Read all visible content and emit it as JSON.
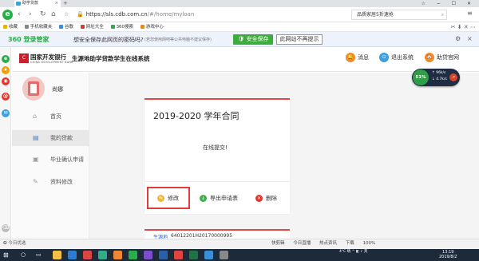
{
  "browser": {
    "tab_title": "助学贷款",
    "tab_close": "×",
    "new_tab": "+",
    "window_controls": "☆ − ☐ ✕",
    "url_domain": "https://sls.cdb.com.cn",
    "url_path": "/#/home/myloan",
    "search_text": "品质家居5折速抢",
    "menu": "≡",
    "bookmarks": [
      "收藏",
      "手机收藏夹",
      "谷歌",
      "网址大全",
      "360搜索",
      "游戏中心"
    ],
    "bookmark_colors": [
      "#f2b000",
      "#888888",
      "#3c8be0",
      "#e2362c",
      "#2aae49",
      "#e88a1a"
    ],
    "password_bar": {
      "brand": "360 登录管家",
      "question": "想安全保存此网页的密码吗?",
      "hint": "(若您使用网吧等公共电脑不建议保存)",
      "save_label": "安全保存",
      "never_label": "此网站不再提示",
      "gear": "⚙",
      "close": "×"
    },
    "status_left": "今日优选",
    "status_right": [
      "快剪辑",
      "今日直播",
      "热点资讯",
      "下载",
      "",
      "100%"
    ]
  },
  "site": {
    "bank_name": "国家开发银行",
    "bank_name_en": "CHINA DEVELOPMENT BANK",
    "system_title": "生源地助学贷款学生在线系统",
    "header_buttons": [
      {
        "label": "消息",
        "color": "#f08a2c",
        "icon": "🔔"
      },
      {
        "label": "退出系统",
        "color": "#3aa0e0",
        "icon": "⏻"
      },
      {
        "label": "助贷官网",
        "color": "#f08a2c",
        "icon": "🏠"
      }
    ]
  },
  "widget": {
    "percent": "51%",
    "up": "↑ 96k/s",
    "down": "↓ 4.7k/s"
  },
  "user": {
    "name": "尚娜"
  },
  "nav": [
    {
      "label": "首页",
      "icon": "⌂"
    },
    {
      "label": "我的贷款",
      "icon": "▤"
    },
    {
      "label": "毕业确认申请",
      "icon": "▣"
    },
    {
      "label": "资料修改",
      "icon": "✎"
    }
  ],
  "card": {
    "title": "2019-2020 学年合同",
    "status": "在线提交!",
    "actions": [
      {
        "label": "修改",
        "color": "#f2b83a",
        "icon": "✎"
      },
      {
        "label": "导出申请表",
        "color": "#3fae4c",
        "icon": "↓"
      },
      {
        "label": "删除",
        "color": "#e2362c",
        "icon": "✕"
      }
    ]
  },
  "card2": {
    "label": "生源地",
    "number": "64012201H20170000995"
  },
  "taskbar": {
    "weather": "4°C 晴",
    "ime": "英",
    "time": "13:19",
    "date": "2019/8/2"
  }
}
